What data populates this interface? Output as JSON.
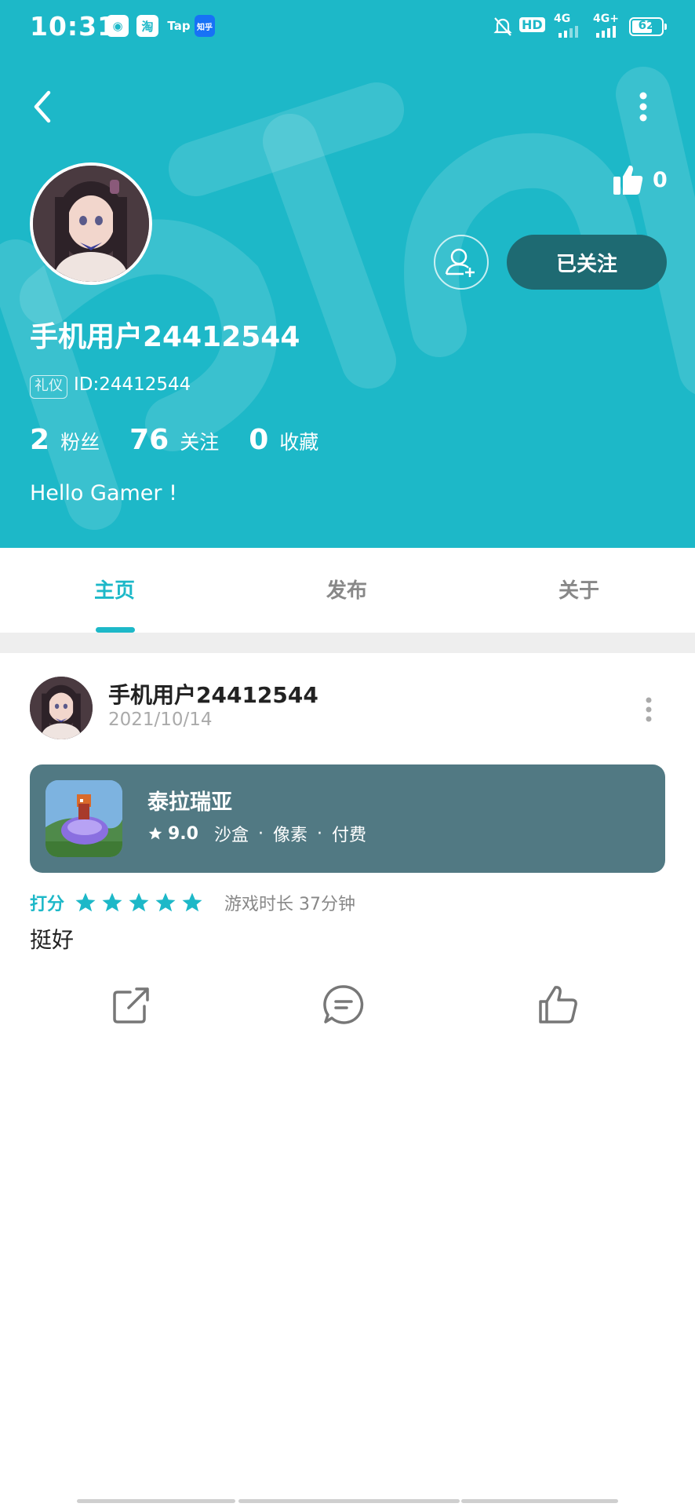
{
  "status_bar": {
    "time": "10:31",
    "apps": [
      "淘",
      "Tap",
      "知乎"
    ],
    "network": "HD",
    "signal_1": "4G",
    "signal_2": "4G+",
    "battery": "62"
  },
  "colors": {
    "accent": "#1DB8C8",
    "follow_button": "#1E6A72",
    "game_card": "#517983"
  },
  "profile": {
    "likes": "0",
    "follow_button_label": "已关注",
    "username": "手机用户24412544",
    "badge": "礼仪",
    "id": "ID:24412544",
    "stats": [
      {
        "num": "2",
        "label": "粉丝"
      },
      {
        "num": "76",
        "label": "关注"
      },
      {
        "num": "0",
        "label": "收藏"
      }
    ],
    "bio": "Hello Gamer !"
  },
  "tabs": [
    "主页",
    "发布",
    "关于"
  ],
  "active_tab": "主页",
  "post": {
    "username": "手机用户24412544",
    "date": "2021/10/14",
    "game": {
      "title": "泰拉瑞亚",
      "score": "9.0",
      "tags": [
        "沙盒",
        "像素",
        "付费"
      ]
    },
    "rating_label": "打分",
    "rating_stars": 5,
    "playtime": "游戏时长 37分钟",
    "review": "挺好"
  },
  "icons": [
    "back-arrow-icon",
    "more-vertical-icon",
    "thumbs-up-icon",
    "add-friend-icon",
    "share-icon",
    "comment-icon",
    "like-icon"
  ]
}
